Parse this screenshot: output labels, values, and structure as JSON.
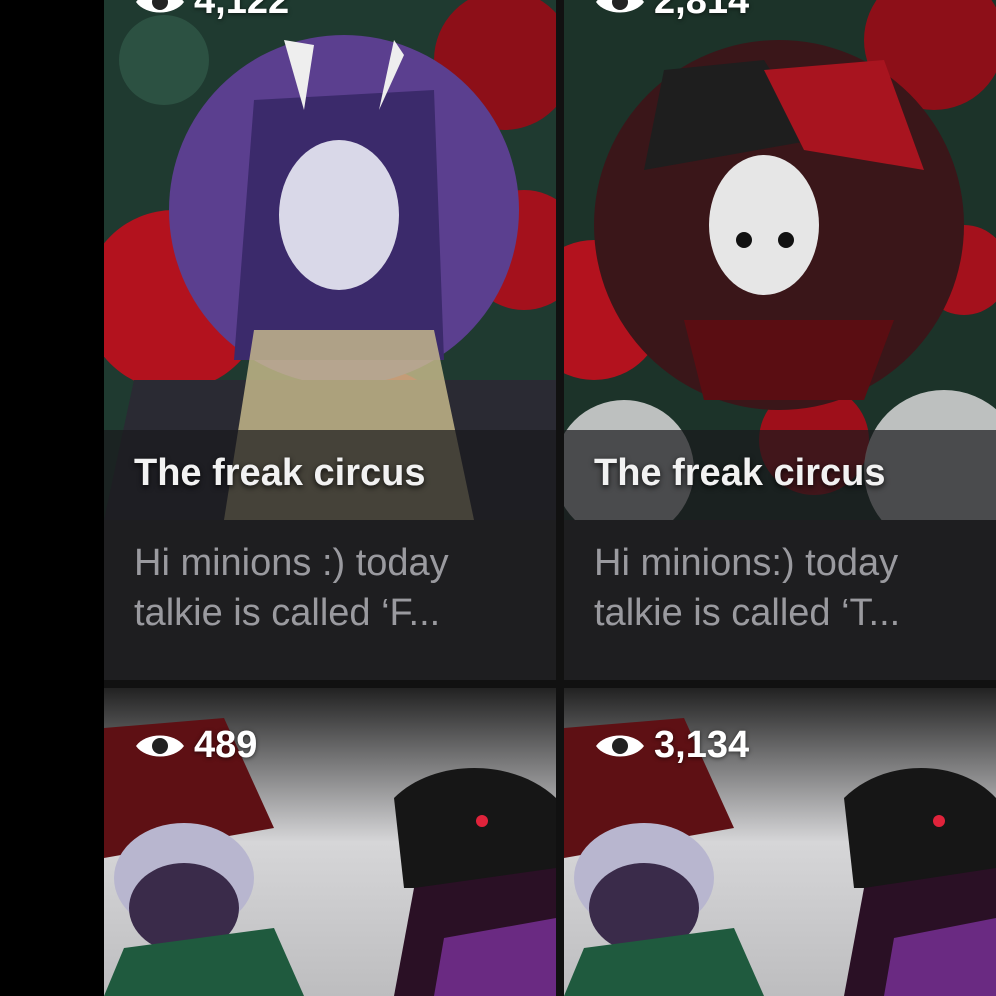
{
  "cards": [
    {
      "views": "4,122",
      "title": "The freak circus",
      "description_line1": "Hi minions :) today",
      "description_line2": "talkie is called ‘F..."
    },
    {
      "views": "2,814",
      "title": "The freak circus",
      "description_line1": "Hi minions:) today",
      "description_line2": "talkie is called ‘T..."
    },
    {
      "views": "489"
    },
    {
      "views": "3,134"
    }
  ],
  "colors": {
    "card_background": "#1e1e20",
    "title_text": "#f2f2f2",
    "description_text": "#9a9a9f",
    "rose_red": "#b3121e",
    "foliage_green": "#1f3a30",
    "character_purple": "#5b3f8f"
  },
  "icons": {
    "views": "eye-icon"
  }
}
